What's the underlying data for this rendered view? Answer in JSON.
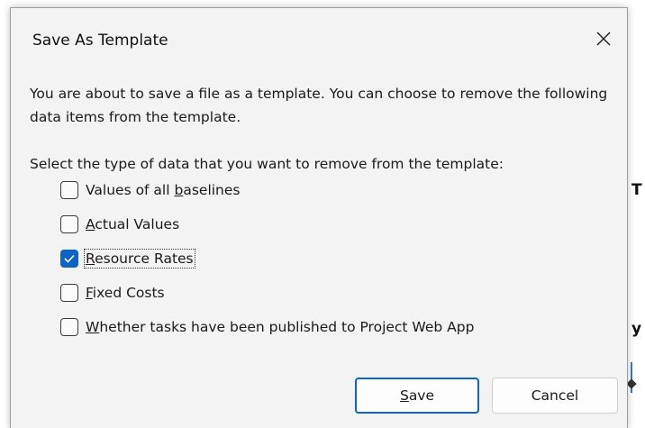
{
  "background": {
    "fragment_1": "T",
    "fragment_2": "y"
  },
  "dialog": {
    "title": "Save As Template",
    "close_icon": "close-icon",
    "description": "You are about to save a file as a template.  You can choose to remove the following data items from the template.",
    "instruction": "Select the type of data that you want to remove from the template:",
    "options": [
      {
        "pre": "Values of all ",
        "key": "b",
        "post": "aselines",
        "checked": false
      },
      {
        "pre": "",
        "key": "A",
        "post": "ctual Values",
        "checked": false
      },
      {
        "pre": "",
        "key": "R",
        "post": "esource Rates",
        "checked": true
      },
      {
        "pre": "",
        "key": "F",
        "post": "ixed Costs",
        "checked": false
      },
      {
        "pre": "",
        "key": "W",
        "post": "hether tasks have been published to Project Web App",
        "checked": false
      }
    ],
    "buttons": {
      "save": {
        "key": "S",
        "post": "ave"
      },
      "cancel": "Cancel"
    },
    "accent_color": "#0f63c4"
  }
}
